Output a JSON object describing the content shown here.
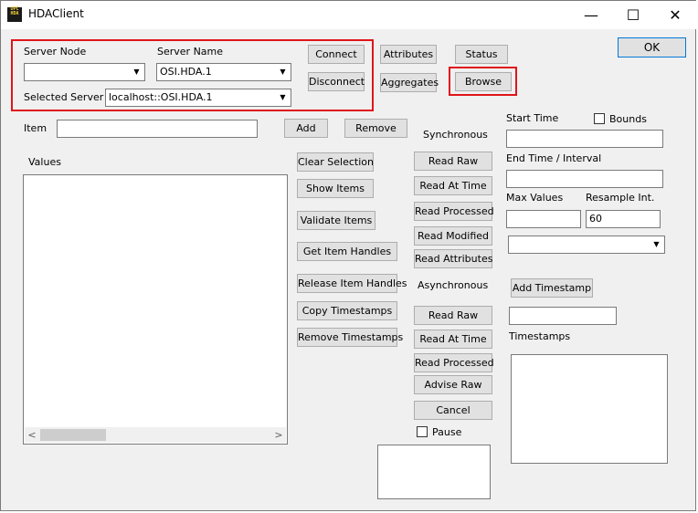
{
  "window": {
    "title": "HDAClient",
    "app_icon_lines": [
      "OPC",
      "HDA"
    ],
    "minimize": "—",
    "maximize": "☐",
    "close": "✕"
  },
  "server": {
    "node_label": "Server Node",
    "node_value": "",
    "name_label": "Server Name",
    "name_value": "OSI.HDA.1",
    "selected_label": "Selected Server",
    "selected_value": "localhost::OSI.HDA.1",
    "connect": "Connect",
    "disconnect": "Disconnect"
  },
  "top_buttons": {
    "attributes": "Attributes",
    "aggregates": "Aggregates",
    "status": "Status",
    "browse": "Browse",
    "ok": "OK"
  },
  "item": {
    "label": "Item",
    "value": "",
    "add": "Add",
    "remove": "Remove"
  },
  "values": {
    "label": "Values"
  },
  "item_buttons": {
    "clear_selection": "Clear Selection",
    "show_items": "Show Items",
    "validate_items": "Validate Items",
    "get_item_handles": "Get Item Handles",
    "release_item_handles": "Release Item Handles",
    "copy_timestamps": "Copy Timestamps",
    "remove_timestamps": "Remove Timestamps"
  },
  "synchronous": {
    "label": "Synchronous",
    "read_raw": "Read Raw",
    "read_at_time": "Read At Time",
    "read_processed": "Read Processed",
    "read_modified": "Read Modified",
    "read_attributes": "Read Attributes"
  },
  "asynchronous": {
    "label": "Asynchronous",
    "read_raw": "Read Raw",
    "read_at_time": "Read At Time",
    "read_processed": "Read Processed",
    "advise_raw": "Advise Raw",
    "cancel": "Cancel",
    "pause": "Pause"
  },
  "time": {
    "start_label": "Start Time",
    "start_value": "",
    "bounds": "Bounds",
    "end_label": "End Time / Interval",
    "end_value": "",
    "max_values_label": "Max Values",
    "max_values_value": "",
    "resample_label": "Resample Int.",
    "resample_value": "60",
    "aggregate_value": ""
  },
  "timestamps": {
    "add": "Add Timestamp",
    "value": "",
    "label": "Timestamps"
  },
  "colors": {
    "highlight": "#e0151b",
    "default_button_border": "#0078d7"
  }
}
